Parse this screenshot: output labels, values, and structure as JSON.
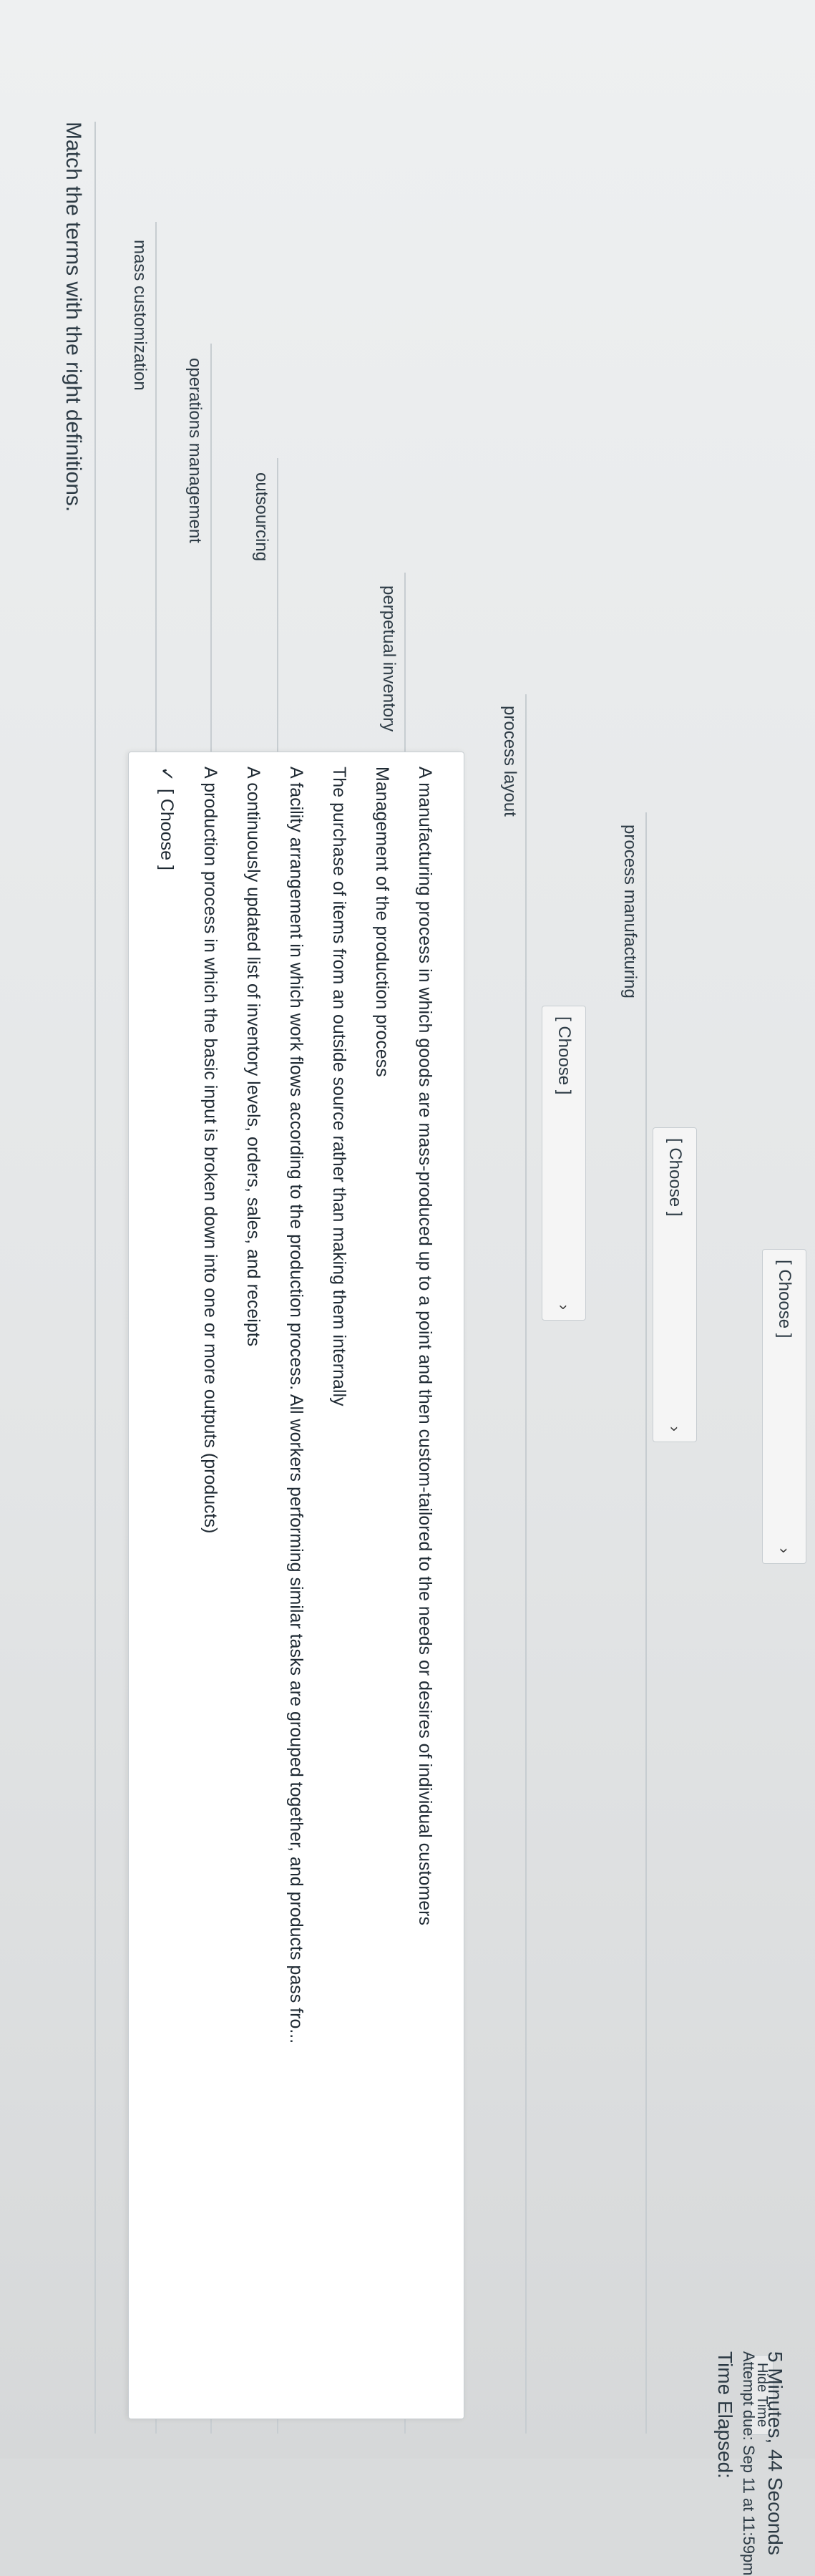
{
  "question": {
    "title": "Match the terms with the right definitions."
  },
  "timer": {
    "label": "Time Elapsed:",
    "hide_label": "Hide Time",
    "attempt_due": "Attempt due: Sep 11 at 11:59pm",
    "elapsed": "5 Minutes, 44 Seconds"
  },
  "terms": [
    {
      "label": "mass customization",
      "selected": "[ Choose ]"
    },
    {
      "label": "operations management",
      "selected": "[ Choose ]"
    },
    {
      "label": "outsourcing",
      "selected": "[ Choose ]"
    },
    {
      "label": "perpetual inventory",
      "selected": "[ Choose ]"
    },
    {
      "label": "process layout",
      "selected": "[ Choose ]"
    },
    {
      "label": "process manufacturing",
      "selected": "[ Choose ]"
    }
  ],
  "dropdown": {
    "options": [
      "[ Choose ]",
      "A production process in which the basic input is broken down into one or more outputs (products)",
      "A continuously updated list of inventory levels, orders, sales, and receipts",
      "A facility arrangement in which work flows according to the production process. All workers performing similar tasks are grouped together, and products pass fro...",
      "The purchase of items from an outside source rather than making them internally",
      "Management of the production process",
      "A manufacturing process in which goods are mass-produced up to a point and then custom-tailored to the needs or desires of individual customers"
    ]
  },
  "icons": {
    "check": "✓",
    "chevron": "›"
  }
}
